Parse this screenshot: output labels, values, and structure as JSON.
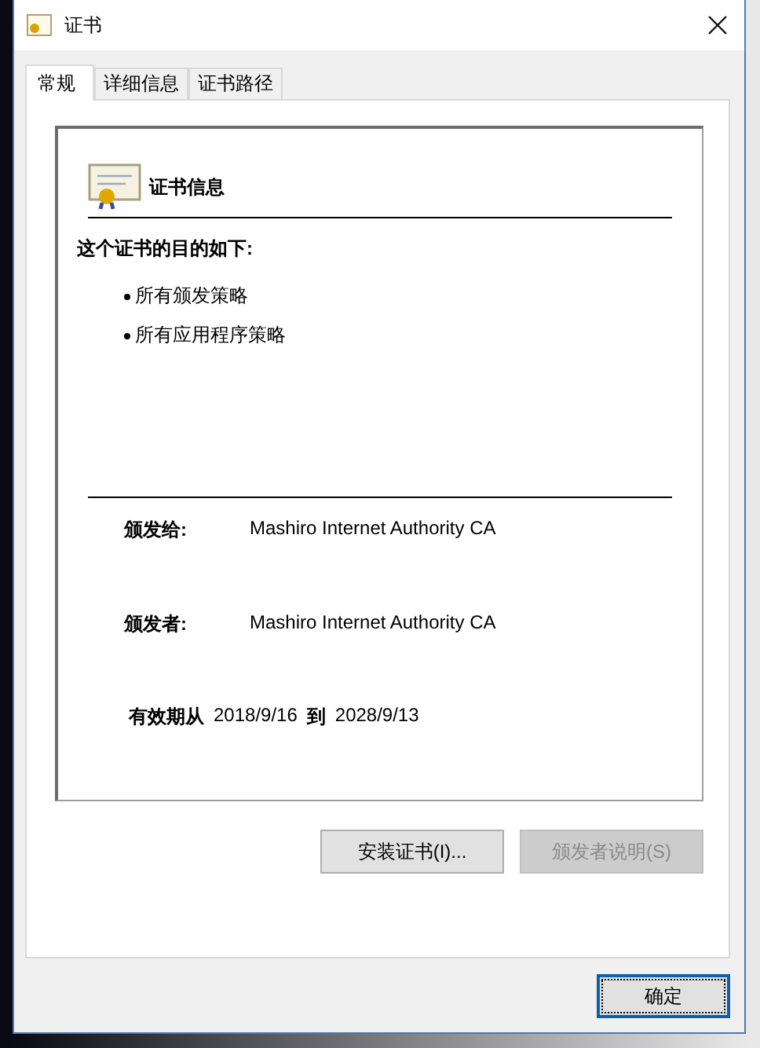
{
  "window": {
    "title": "证书"
  },
  "tabs": [
    {
      "label": "常规",
      "selected": true
    },
    {
      "label": "详细信息",
      "selected": false
    },
    {
      "label": "证书路径",
      "selected": false
    }
  ],
  "info": {
    "heading": "证书信息",
    "purpose_title": "这个证书的目的如下:",
    "purposes": [
      "所有颁发策略",
      "所有应用程序策略"
    ],
    "issued_to": {
      "label": "颁发给:",
      "value": "Mashiro Internet Authority CA"
    },
    "issued_by": {
      "label": "颁发者:",
      "value": "Mashiro Internet Authority CA"
    },
    "validity": {
      "label": "有效期从",
      "from": "2018/9/16",
      "separator": "到",
      "to": "2028/9/13"
    }
  },
  "panel_buttons": [
    {
      "label": "安装证书(I)...",
      "disabled": false
    },
    {
      "label": "颁发者说明(S)",
      "disabled": true
    }
  ],
  "ok_button": {
    "label": "确定",
    "focused": true
  }
}
